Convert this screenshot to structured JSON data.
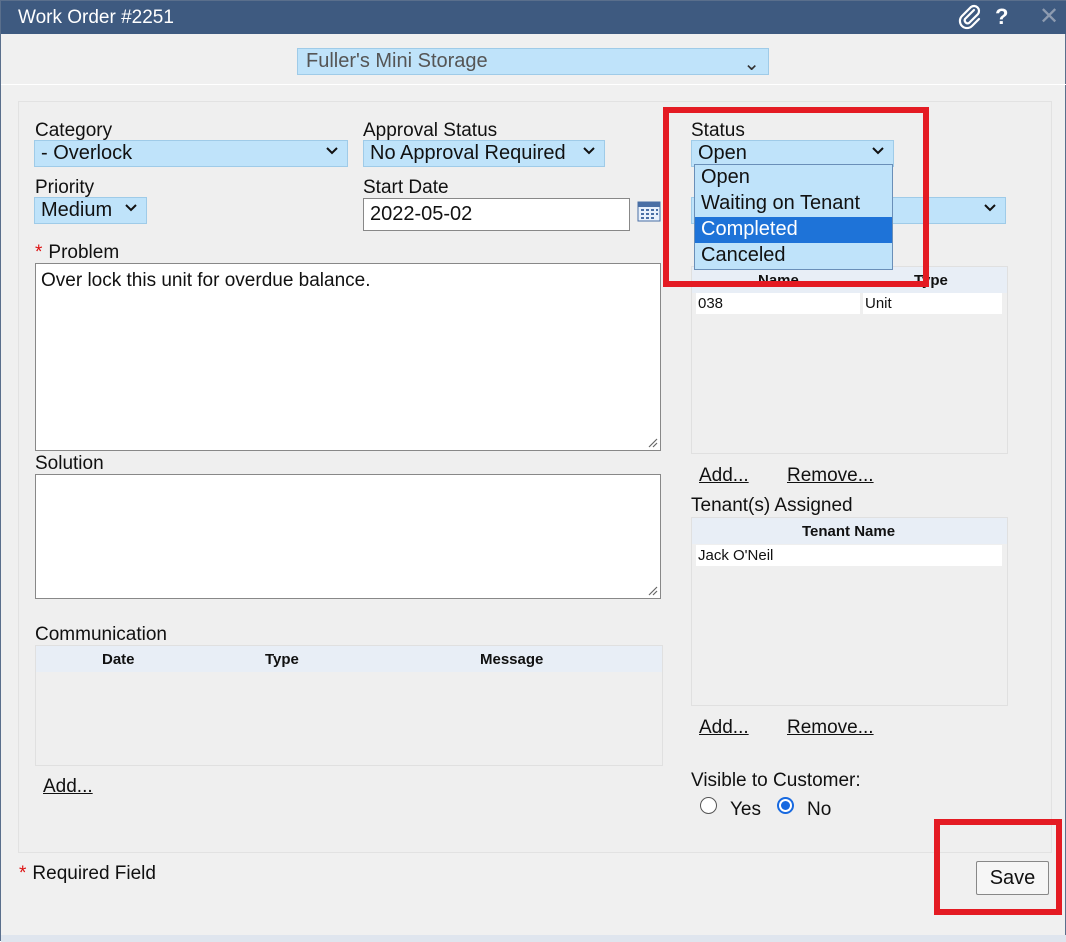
{
  "window": {
    "title": "Work Order #2251"
  },
  "facility": {
    "selected": "Fuller's Mini Storage"
  },
  "category": {
    "label": "Category",
    "selected": "- Overlock"
  },
  "approval": {
    "label": "Approval Status",
    "selected": "No Approval Required"
  },
  "status": {
    "label": "Status",
    "selected": "Open",
    "options": [
      "Open",
      "Waiting on Tenant",
      "Completed",
      "Canceled"
    ],
    "highlighted_option": "Completed"
  },
  "priority": {
    "label": "Priority",
    "selected": "Medium"
  },
  "start_date": {
    "label": "Start Date",
    "value": "2022-05-02"
  },
  "problem": {
    "required_mark": "*",
    "label": "Problem",
    "value": "Over lock this unit for overdue balance."
  },
  "solution": {
    "label": "Solution",
    "value": ""
  },
  "communication": {
    "label": "Communication",
    "columns": [
      "Date",
      "Type",
      "Message"
    ],
    "add_label": "Add..."
  },
  "units": {
    "columns": [
      "Name",
      "Type"
    ],
    "rows": [
      {
        "name": "038",
        "type": "Unit"
      }
    ],
    "add_label": "Add...",
    "remove_label": "Remove..."
  },
  "tenants": {
    "label": "Tenant(s) Assigned",
    "columns": [
      "Tenant Name"
    ],
    "rows": [
      "Jack O'Neil"
    ],
    "add_label": "Add...",
    "remove_label": "Remove..."
  },
  "visible": {
    "label": "Visible to Customer:",
    "yes_label": "Yes",
    "no_label": "No",
    "selected": "No"
  },
  "footer": {
    "required_mark": "*",
    "required_text": "Required Field",
    "save_label": "Save"
  },
  "colors": {
    "titlebar": "#3e5a80",
    "select_bg": "#bfe3fa",
    "selected_option": "#1e73d8",
    "highlight": "#e41b23"
  },
  "icons": [
    "paperclip-icon",
    "help-icon",
    "close-icon",
    "calendar-icon",
    "chevron-down-icon"
  ]
}
